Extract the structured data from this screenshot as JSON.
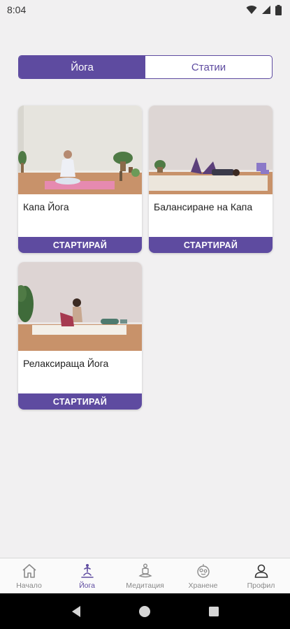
{
  "status_bar": {
    "time": "8:04"
  },
  "tabs": [
    {
      "label": "Йога",
      "active": true
    },
    {
      "label": "Статии",
      "active": false
    }
  ],
  "cards": [
    {
      "title": "Капа Йога",
      "button": "СТАРТИРАЙ"
    },
    {
      "title": "Балансиране на Капа",
      "button": "СТАРТИРАЙ"
    },
    {
      "title": "Релаксираща Йога",
      "button": "СТАРТИРАЙ"
    }
  ],
  "bottom_nav": [
    {
      "label": "Начало",
      "icon": "home-icon",
      "active": false
    },
    {
      "label": "Йога",
      "icon": "yoga-icon",
      "active": true
    },
    {
      "label": "Медитация",
      "icon": "meditation-icon",
      "active": false
    },
    {
      "label": "Хранене",
      "icon": "nutrition-icon",
      "active": false
    },
    {
      "label": "Профил",
      "icon": "profile-icon",
      "active": false
    }
  ],
  "colors": {
    "accent": "#5e4ba0",
    "background": "#f1f0f1"
  }
}
